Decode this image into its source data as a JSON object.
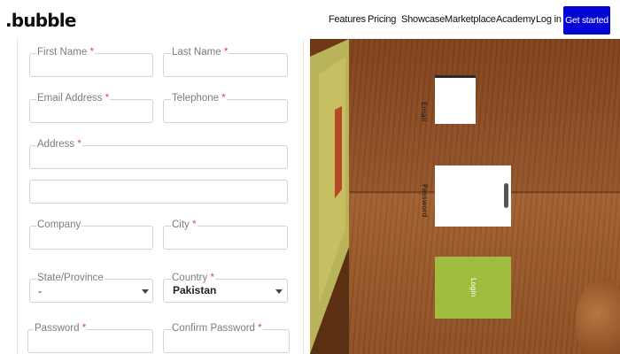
{
  "nav": {
    "logo": ".bubble",
    "links": [
      "Features",
      "Pricing",
      "Showcase",
      "Marketplace",
      "Academy",
      "Log in"
    ],
    "cta": "Get started",
    "cta_color": "#0205d3"
  },
  "form": {
    "required_marker": "*",
    "first_name": {
      "label": "First Name"
    },
    "last_name": {
      "label": "Last Name"
    },
    "email": {
      "label": "Email Address"
    },
    "telephone": {
      "label": "Telephone"
    },
    "address": {
      "label": "Address"
    },
    "company": {
      "label": "Company"
    },
    "city": {
      "label": "City"
    },
    "state": {
      "label": "State/Province",
      "value": "-"
    },
    "country": {
      "label": "Country",
      "value": "Pakistan"
    },
    "password": {
      "label": "Password"
    },
    "confirm_password": {
      "label": "Confirm Password"
    },
    "required_color": "#e0474c"
  },
  "scene": {
    "field1_label": "Email",
    "field2_label": "Password",
    "button_label": "Login",
    "button_color": "#9fbd3f"
  }
}
